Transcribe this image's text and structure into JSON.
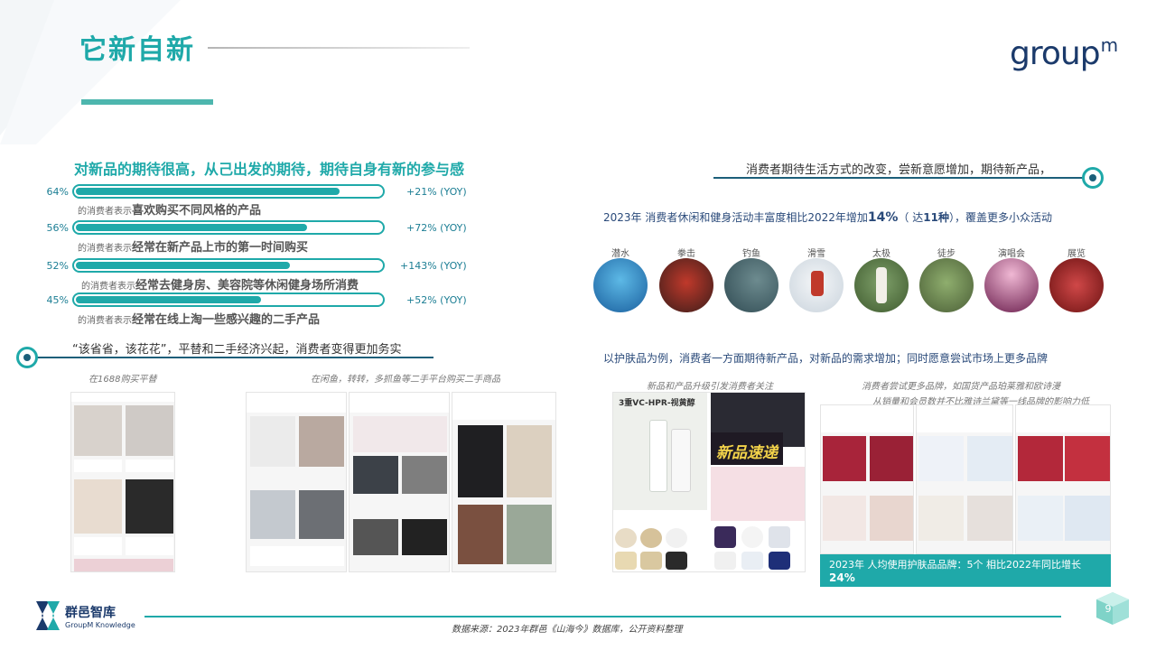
{
  "title": "它新自新",
  "logo": {
    "text": "group",
    "sup": "m"
  },
  "left": {
    "heading": "对新品的期待很高，从己出发的期待，期待自身有新的参与感",
    "stats": [
      {
        "pct_label": "64%",
        "value": 0.64,
        "yoy": "+21% (YOY)",
        "prefix": "的消费者表示",
        "desc": "喜欢购买不同风格的产品"
      },
      {
        "pct_label": "56%",
        "value": 0.56,
        "yoy": "+72% (YOY)",
        "prefix": "的消费者表示",
        "desc": "经常在新产品上市的第一时间购买"
      },
      {
        "pct_label": "52%",
        "value": 0.52,
        "yoy": "+143% (YOY)",
        "prefix": "的消费者表示",
        "desc": "经常去健身房、美容院等休闲健身场所消费"
      },
      {
        "pct_label": "45%",
        "value": 0.45,
        "yoy": "+52% (YOY)",
        "prefix": "的消费者表示",
        "desc": "经常在线上淘一些感兴趣的二手产品"
      }
    ],
    "section_heading": "“该省省，该花花”，平替和二手经济兴起，消费者变得更加务实",
    "caption_1688": "在1688购买平替",
    "caption_secondhand": "在闲鱼，转转，多抓鱼等二手平台购买二手商品"
  },
  "right": {
    "section_heading": "消费者期待生活方式的改变，尝新意愿增加，期待新产品，",
    "intro_a": "2023年 消费者休闲和健身活动丰富度相比2022年增加",
    "intro_pct": "14%",
    "intro_b": "（ 达",
    "intro_count": "11种",
    "intro_c": "），覆盖更多小众活动",
    "activities": [
      "潜水",
      "拳击",
      "钓鱼",
      "滑雪",
      "太极",
      "徒步",
      "演唱会",
      "展览"
    ],
    "skincare_line": "以护肤品为例，消费者一方面期待新产品，对新品的需求增加；同时愿意尝试市场上更多品牌",
    "caption_newproduct": "新品和产品升级引发消费者关注",
    "caption_brands_1": "消费者尝试更多品牌，如国货产品珀莱雅和欧诗漫",
    "caption_brands_2": "从销量和会员数并不比雅诗兰黛等一线品牌的影响力低",
    "new_product_tag": "新品速递",
    "product_headline": "3重VC-HPR-视黄醇",
    "banner_a": "2023年 人均使用护肤品品牌：",
    "banner_num": "5个",
    "banner_b": "  相比2022年同比增长",
    "banner_pct": "24%"
  },
  "footer": {
    "source": "数据来源：2023年群邑《山海今》数据库，公开资料整理",
    "brand": "群邑智库",
    "brand_en": "GroupM Knowledge",
    "page": "9"
  },
  "colors": {
    "accent": "#1fa9a9",
    "navy": "#1b3a6b"
  }
}
